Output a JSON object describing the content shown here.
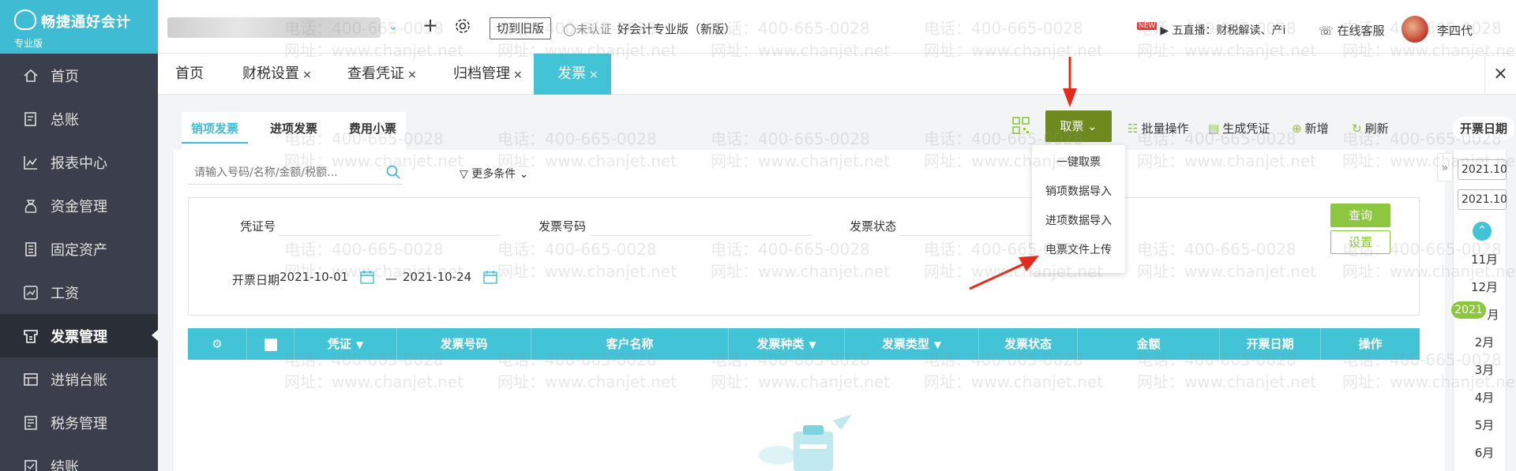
{
  "app": {
    "name": "畅捷通好会计",
    "edition": "专业版"
  },
  "sidebar": {
    "items": [
      {
        "label": "首页",
        "icon": "home-icon"
      },
      {
        "label": "总账",
        "icon": "ledger-icon"
      },
      {
        "label": "报表中心",
        "icon": "chart-icon"
      },
      {
        "label": "资金管理",
        "icon": "wallet-icon"
      },
      {
        "label": "固定资产",
        "icon": "asset-icon"
      },
      {
        "label": "工资",
        "icon": "salary-icon"
      },
      {
        "label": "发票管理",
        "icon": "invoice-icon",
        "active": true
      },
      {
        "label": "进销台账",
        "icon": "stock-icon"
      },
      {
        "label": "税务管理",
        "icon": "tax-icon"
      },
      {
        "label": "结账",
        "icon": "close-period-icon"
      }
    ]
  },
  "header": {
    "switch_old": "切到旧版",
    "unverified": "未认证",
    "product": "好会计专业版（新版）",
    "live_badge": "NEW",
    "live_text": "五直播：财税解读、产i",
    "service": "在线客服",
    "user": "李四代"
  },
  "tabs": [
    {
      "label": "首页",
      "closable": false
    },
    {
      "label": "财税设置",
      "closable": true
    },
    {
      "label": "查看凭证",
      "closable": true
    },
    {
      "label": "归档管理",
      "closable": true
    },
    {
      "label": "发票",
      "closable": true,
      "active": true
    }
  ],
  "close_glyph": "×",
  "subtabs": [
    "销项发票",
    "进项发票",
    "费用小票"
  ],
  "toolbar": {
    "fetch": "取票",
    "batch": "批量操作",
    "gen_voucher": "生成凭证",
    "add": "新增",
    "refresh": "刷新"
  },
  "dropdown": [
    "一键取票",
    "销项数据导入",
    "进项数据导入",
    "电票文件上传"
  ],
  "search": {
    "placeholder": "请输入号码/名称/金额/税额..."
  },
  "more_conditions": "更多条件",
  "filters": {
    "voucher_no": "凭证号",
    "invoice_no": "发票号码",
    "invoice_status": "发票状态",
    "date_label": "开票日期",
    "date_from": "2021-10-01",
    "date_sep": "—",
    "date_to": "2021-10-24"
  },
  "buttons": {
    "query": "查询",
    "settings": "设置"
  },
  "table": {
    "columns": [
      "凭证",
      "发票号码",
      "客户名称",
      "发票种类",
      "发票类型",
      "发票状态",
      "金额",
      "开票日期",
      "操作"
    ]
  },
  "rail": {
    "title": "开票日期",
    "date1": "2021.10",
    "date2": "2021.10",
    "year": "2021",
    "months_top": [
      "11月",
      "12月"
    ],
    "months_bottom": [
      "2月",
      "3月",
      "4月",
      "5月",
      "6月"
    ],
    "partial_month": "月"
  },
  "watermark": {
    "phone": "电话：400-665-0028",
    "site": "网址：www.chanjet.net"
  },
  "colors": {
    "accent": "#43c3d6",
    "green": "#8dc63f",
    "fetch": "#6e8a1f",
    "sidebar": "#3a3f4b"
  }
}
